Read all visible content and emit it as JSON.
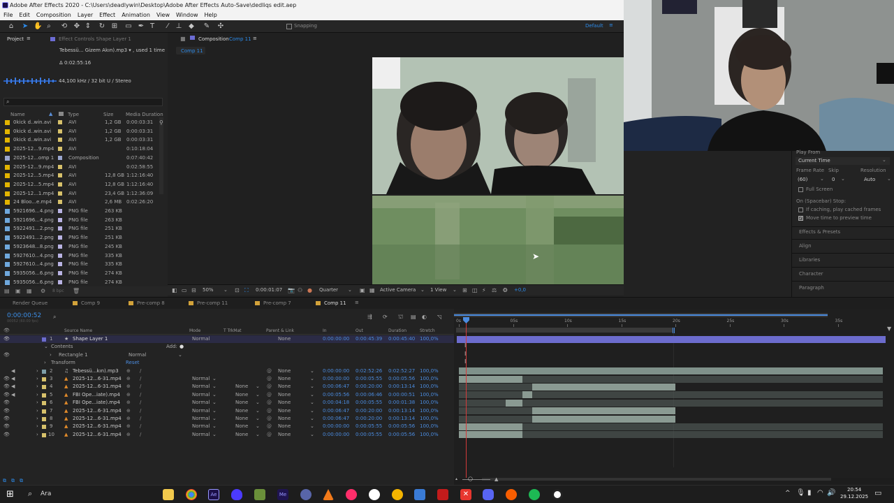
{
  "window": {
    "title": "Adobe After Effects 2020 - C:\\Users\\deadlywin\\Desktop\\Adobe After Effects Auto-Save\\dedliqs edit.aep"
  },
  "menu": [
    "File",
    "Edit",
    "Composition",
    "Layer",
    "Effect",
    "Animation",
    "View",
    "Window",
    "Help"
  ],
  "toolbar": {
    "snapping": "Snapping",
    "workspace": "Default"
  },
  "project": {
    "tab": "Project",
    "effect_controls": "Effect Controls Shape Layer 1",
    "selected_name": "Tebessü... Gizem Akın).mp3 ▾ , used 1 time",
    "duration": "Δ 0:02:55:16",
    "audio_info": "44,100 kHz / 32 bit U / Stereo",
    "search_placeholder": "",
    "columns": {
      "name": "Name",
      "type": "Type",
      "size": "Size",
      "media_duration": "Media Duration"
    },
    "files": [
      {
        "name": "0kick d..win.avi",
        "type": "AVI",
        "size": "1,2 GB",
        "duration": "0:00:03:31",
        "color": "#e2b400"
      },
      {
        "name": "0kick d..win.avi",
        "type": "AVI",
        "size": "1,2 GB",
        "duration": "0:00:03:31",
        "color": "#e2b400"
      },
      {
        "name": "0kick d..win.avi",
        "type": "AVI",
        "size": "1,2 GB",
        "duration": "0:00:03:31",
        "color": "#e2b400"
      },
      {
        "name": "2025-12...9.mp4",
        "type": "AVI",
        "size": "",
        "duration": "0:10:18:04",
        "color": "#e2b400"
      },
      {
        "name": "2025-12...omp 1",
        "type": "Composition",
        "size": "",
        "duration": "0:07:40:42",
        "color": "#9ba7cf"
      },
      {
        "name": "2025-12...9.mp4",
        "type": "AVI",
        "size": "",
        "duration": "0:02:58:55",
        "color": "#e2b400"
      },
      {
        "name": "2025-12...5.mp4",
        "type": "AVI",
        "size": "12,8 GB",
        "duration": "1:12:16:40",
        "color": "#e2b400"
      },
      {
        "name": "2025-12...5.mp4",
        "type": "AVI",
        "size": "12,8 GB",
        "duration": "1:12:16:40",
        "color": "#e2b400"
      },
      {
        "name": "2025-12...1.mp4",
        "type": "AVI",
        "size": "23,4 GB",
        "duration": "1:12:36:09",
        "color": "#e2b400"
      },
      {
        "name": "24 Bloo...e.mp4",
        "type": "AVI",
        "size": "2,6 MB",
        "duration": "0:02:26:20",
        "color": "#e2b400"
      },
      {
        "name": "5921696...4.png",
        "type": "PNG file",
        "size": "263 KB",
        "duration": "",
        "color": "#6fa8dc"
      },
      {
        "name": "5921696...4.png",
        "type": "PNG file",
        "size": "263 KB",
        "duration": "",
        "color": "#6fa8dc"
      },
      {
        "name": "5922491...2.png",
        "type": "PNG file",
        "size": "251 KB",
        "duration": "",
        "color": "#6fa8dc"
      },
      {
        "name": "5922491...2.png",
        "type": "PNG file",
        "size": "251 KB",
        "duration": "",
        "color": "#6fa8dc"
      },
      {
        "name": "5923648...8.png",
        "type": "PNG file",
        "size": "245 KB",
        "duration": "",
        "color": "#6fa8dc"
      },
      {
        "name": "5927610...4.png",
        "type": "PNG file",
        "size": "335 KB",
        "duration": "",
        "color": "#6fa8dc"
      },
      {
        "name": "5927610...4.png",
        "type": "PNG file",
        "size": "335 KB",
        "duration": "",
        "color": "#6fa8dc"
      },
      {
        "name": "5935056...6.png",
        "type": "PNG file",
        "size": "274 KB",
        "duration": "",
        "color": "#6fa8dc"
      },
      {
        "name": "5935056...6.png",
        "type": "PNG file",
        "size": "274 KB",
        "duration": "",
        "color": "#6fa8dc"
      }
    ],
    "bpc": "8 bpc"
  },
  "composition": {
    "tab": "Composition",
    "comp_name": "Comp 11",
    "sub_tab": "Comp 11",
    "zoom": "50%",
    "time": "0:00:01:07",
    "resolution": "Quarter",
    "camera": "Active Camera",
    "view": "1 View",
    "exposure": "+0,0"
  },
  "preview": {
    "play_from_label": "Play From",
    "play_from": "Current Time",
    "frame_rate_label": "Frame Rate",
    "skip_label": "Skip",
    "resolution_label": "Resolution",
    "frame_rate": "(60)",
    "skip": "0",
    "resolution": "Auto",
    "full_screen": "Full Screen",
    "on_stop": "On (Spacebar) Stop:",
    "if_caching": "If caching, play cached frames",
    "move_time": "Move time to preview time",
    "panels": [
      "Effects & Presets",
      "Align",
      "Libraries",
      "Character",
      "Paragraph"
    ]
  },
  "timeline_tabs": [
    "Render Queue",
    "Comp 9",
    "Pre-comp 8",
    "Pre-comp 11",
    "Pre-comp 7",
    "Comp 11"
  ],
  "timeline": {
    "current_time": "0:00:00:52",
    "fps_note": "00052 (60.00 fps)",
    "columns": {
      "source_name": "Source Name",
      "mode": "Mode",
      "trkmat": "T  TrkMat",
      "parent": "Parent & Link",
      "in": "In",
      "out": "Out",
      "duration": "Duration",
      "stretch": "Stretch"
    },
    "ruler": [
      "0s",
      "05s",
      "10s",
      "15s",
      "20s",
      "25s",
      "30s",
      "35s"
    ],
    "layer1": {
      "num": "1",
      "name": "Shape Layer 1",
      "mode": "Normal",
      "parent": "None",
      "in": "0:00:00:00",
      "out": "0:00:45:39",
      "duration": "0:00:45:40",
      "stretch": "100,0%"
    },
    "contents": "Contents",
    "add": "Add:",
    "rectangle": "Rectangle 1",
    "rect_mode": "Normal",
    "transform": "Transform",
    "reset": "Reset",
    "layers": [
      {
        "num": "2",
        "name": "Tebessü...kın).mp3",
        "mode": "",
        "trk": "",
        "parent": "None",
        "in": "0:00:00:00",
        "out": "0:02:52:26",
        "dur": "0:02:52:27",
        "stretch": "100,0%",
        "bar_start_s": 0,
        "bar_end_s": 39
      },
      {
        "num": "3",
        "name": "2025-12...6-31.mp4",
        "mode": "Normal",
        "trk": "",
        "parent": "None",
        "in": "0:00:00:00",
        "out": "0:00:05:55",
        "dur": "0:00:05:56",
        "stretch": "100,0%",
        "bar_start_s": 0,
        "bar_end_s": 5.9
      },
      {
        "num": "4",
        "name": "2025-12...6-31.mp4",
        "mode": "Normal",
        "trk": "None",
        "parent": "None",
        "in": "0:00:06:47",
        "out": "0:00:20:00",
        "dur": "0:00:13:14",
        "stretch": "100,0%",
        "bar_start_s": 6.8,
        "bar_end_s": 20
      },
      {
        "num": "5",
        "name": "FBI Ope...iate).mp4",
        "mode": "Normal",
        "trk": "None",
        "parent": "None",
        "in": "0:00:05:56",
        "out": "0:00:06:46",
        "dur": "0:00:00:51",
        "stretch": "100,0%",
        "bar_start_s": 5.9,
        "bar_end_s": 6.8
      },
      {
        "num": "6",
        "name": "FBI Ope...iate).mp4",
        "mode": "Normal",
        "trk": "None",
        "parent": "None",
        "in": "0:00:04:18",
        "out": "0:00:05:55",
        "dur": "0:00:01:38",
        "stretch": "100,0%",
        "bar_start_s": 4.3,
        "bar_end_s": 5.9
      },
      {
        "num": "7",
        "name": "2025-12...6-31.mp4",
        "mode": "Normal",
        "trk": "None",
        "parent": "None",
        "in": "0:00:06:47",
        "out": "0:00:20:00",
        "dur": "0:00:13:14",
        "stretch": "100,0%",
        "bar_start_s": 6.8,
        "bar_end_s": 20
      },
      {
        "num": "8",
        "name": "2025-12...6-31.mp4",
        "mode": "Normal",
        "trk": "None",
        "parent": "None",
        "in": "0:00:06:47",
        "out": "0:00:20:00",
        "dur": "0:00:13:14",
        "stretch": "100,0%",
        "bar_start_s": 6.8,
        "bar_end_s": 20
      },
      {
        "num": "9",
        "name": "2025-12...6-31.mp4",
        "mode": "Normal",
        "trk": "None",
        "parent": "None",
        "in": "0:00:00:00",
        "out": "0:00:05:55",
        "dur": "0:00:05:56",
        "stretch": "100,0%",
        "bar_start_s": 0,
        "bar_end_s": 5.9
      },
      {
        "num": "10",
        "name": "2025-12...6-31.mp4",
        "mode": "Normal",
        "trk": "None",
        "parent": "None",
        "in": "0:00:00:00",
        "out": "0:00:05:55",
        "dur": "0:00:05:56",
        "stretch": "100,0%",
        "bar_start_s": 0,
        "bar_end_s": 5.9
      }
    ]
  },
  "taskbar": {
    "search": "Ara",
    "time": "20:54",
    "date": "29.12.2025"
  }
}
